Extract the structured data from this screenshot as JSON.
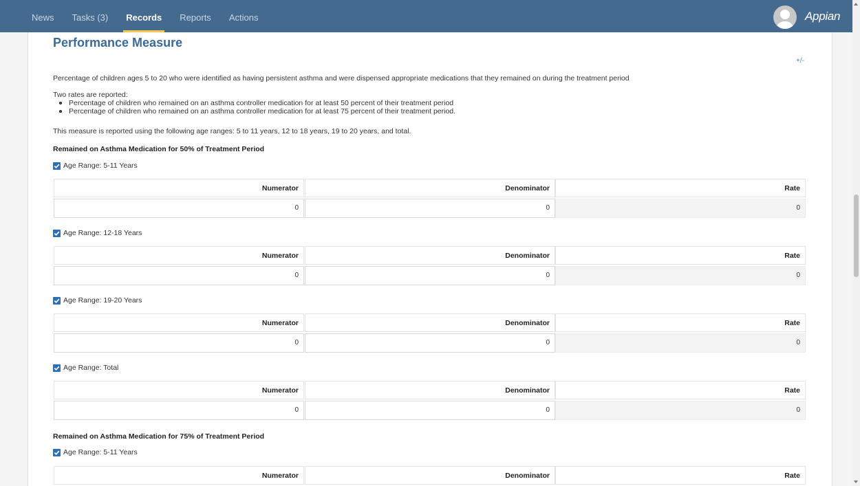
{
  "nav": {
    "items": [
      "News",
      "Tasks (3)",
      "Records",
      "Reports",
      "Actions"
    ],
    "active": "Records",
    "brand": "Appian"
  },
  "page": {
    "title": "Performance Measure",
    "toggle": "+/-",
    "description": "Percentage of children ages 5 to 20 who were identified as having persistent asthma and were dispensed appropriate medications that they remained on during the treatment period",
    "rates_intro": "Two rates are reported:",
    "bullets": [
      "Percentage of children who remained on an asthma controller medication for at least 50 percent of their treatment period",
      "Percentage of children who remained on an asthma controller medication for at least 75 percent of their treatment period."
    ],
    "age_ranges_note": "This measure is reported using the following age ranges: 5 to 11 years, 12 to 18 years, 19 to 20 years, and total."
  },
  "columns": {
    "numerator": "Numerator",
    "denominator": "Denominator",
    "rate": "Rate"
  },
  "sections": [
    {
      "heading": "Remained on Asthma Medication for 50% of Treatment Period",
      "groups": [
        {
          "label": "Age Range: 5-11 Years",
          "checked": true,
          "numerator": "0",
          "denominator": "0",
          "rate": "0"
        },
        {
          "label": "Age Range: 12-18 Years",
          "checked": true,
          "numerator": "0",
          "denominator": "0",
          "rate": "0"
        },
        {
          "label": "Age Range: 19-20 Years",
          "checked": true,
          "numerator": "0",
          "denominator": "0",
          "rate": "0"
        },
        {
          "label": "Age Range: Total",
          "checked": true,
          "numerator": "0",
          "denominator": "0",
          "rate": "0"
        }
      ]
    },
    {
      "heading": "Remained on Asthma Medication for 75% of Treatment Period",
      "groups": [
        {
          "label": "Age Range: 5-11 Years",
          "checked": true
        }
      ]
    }
  ],
  "colors": {
    "nav_bg": "#446a8f",
    "accent": "#f2c94c",
    "title": "#3b6a98",
    "checkbox": "#2f6fb5"
  }
}
